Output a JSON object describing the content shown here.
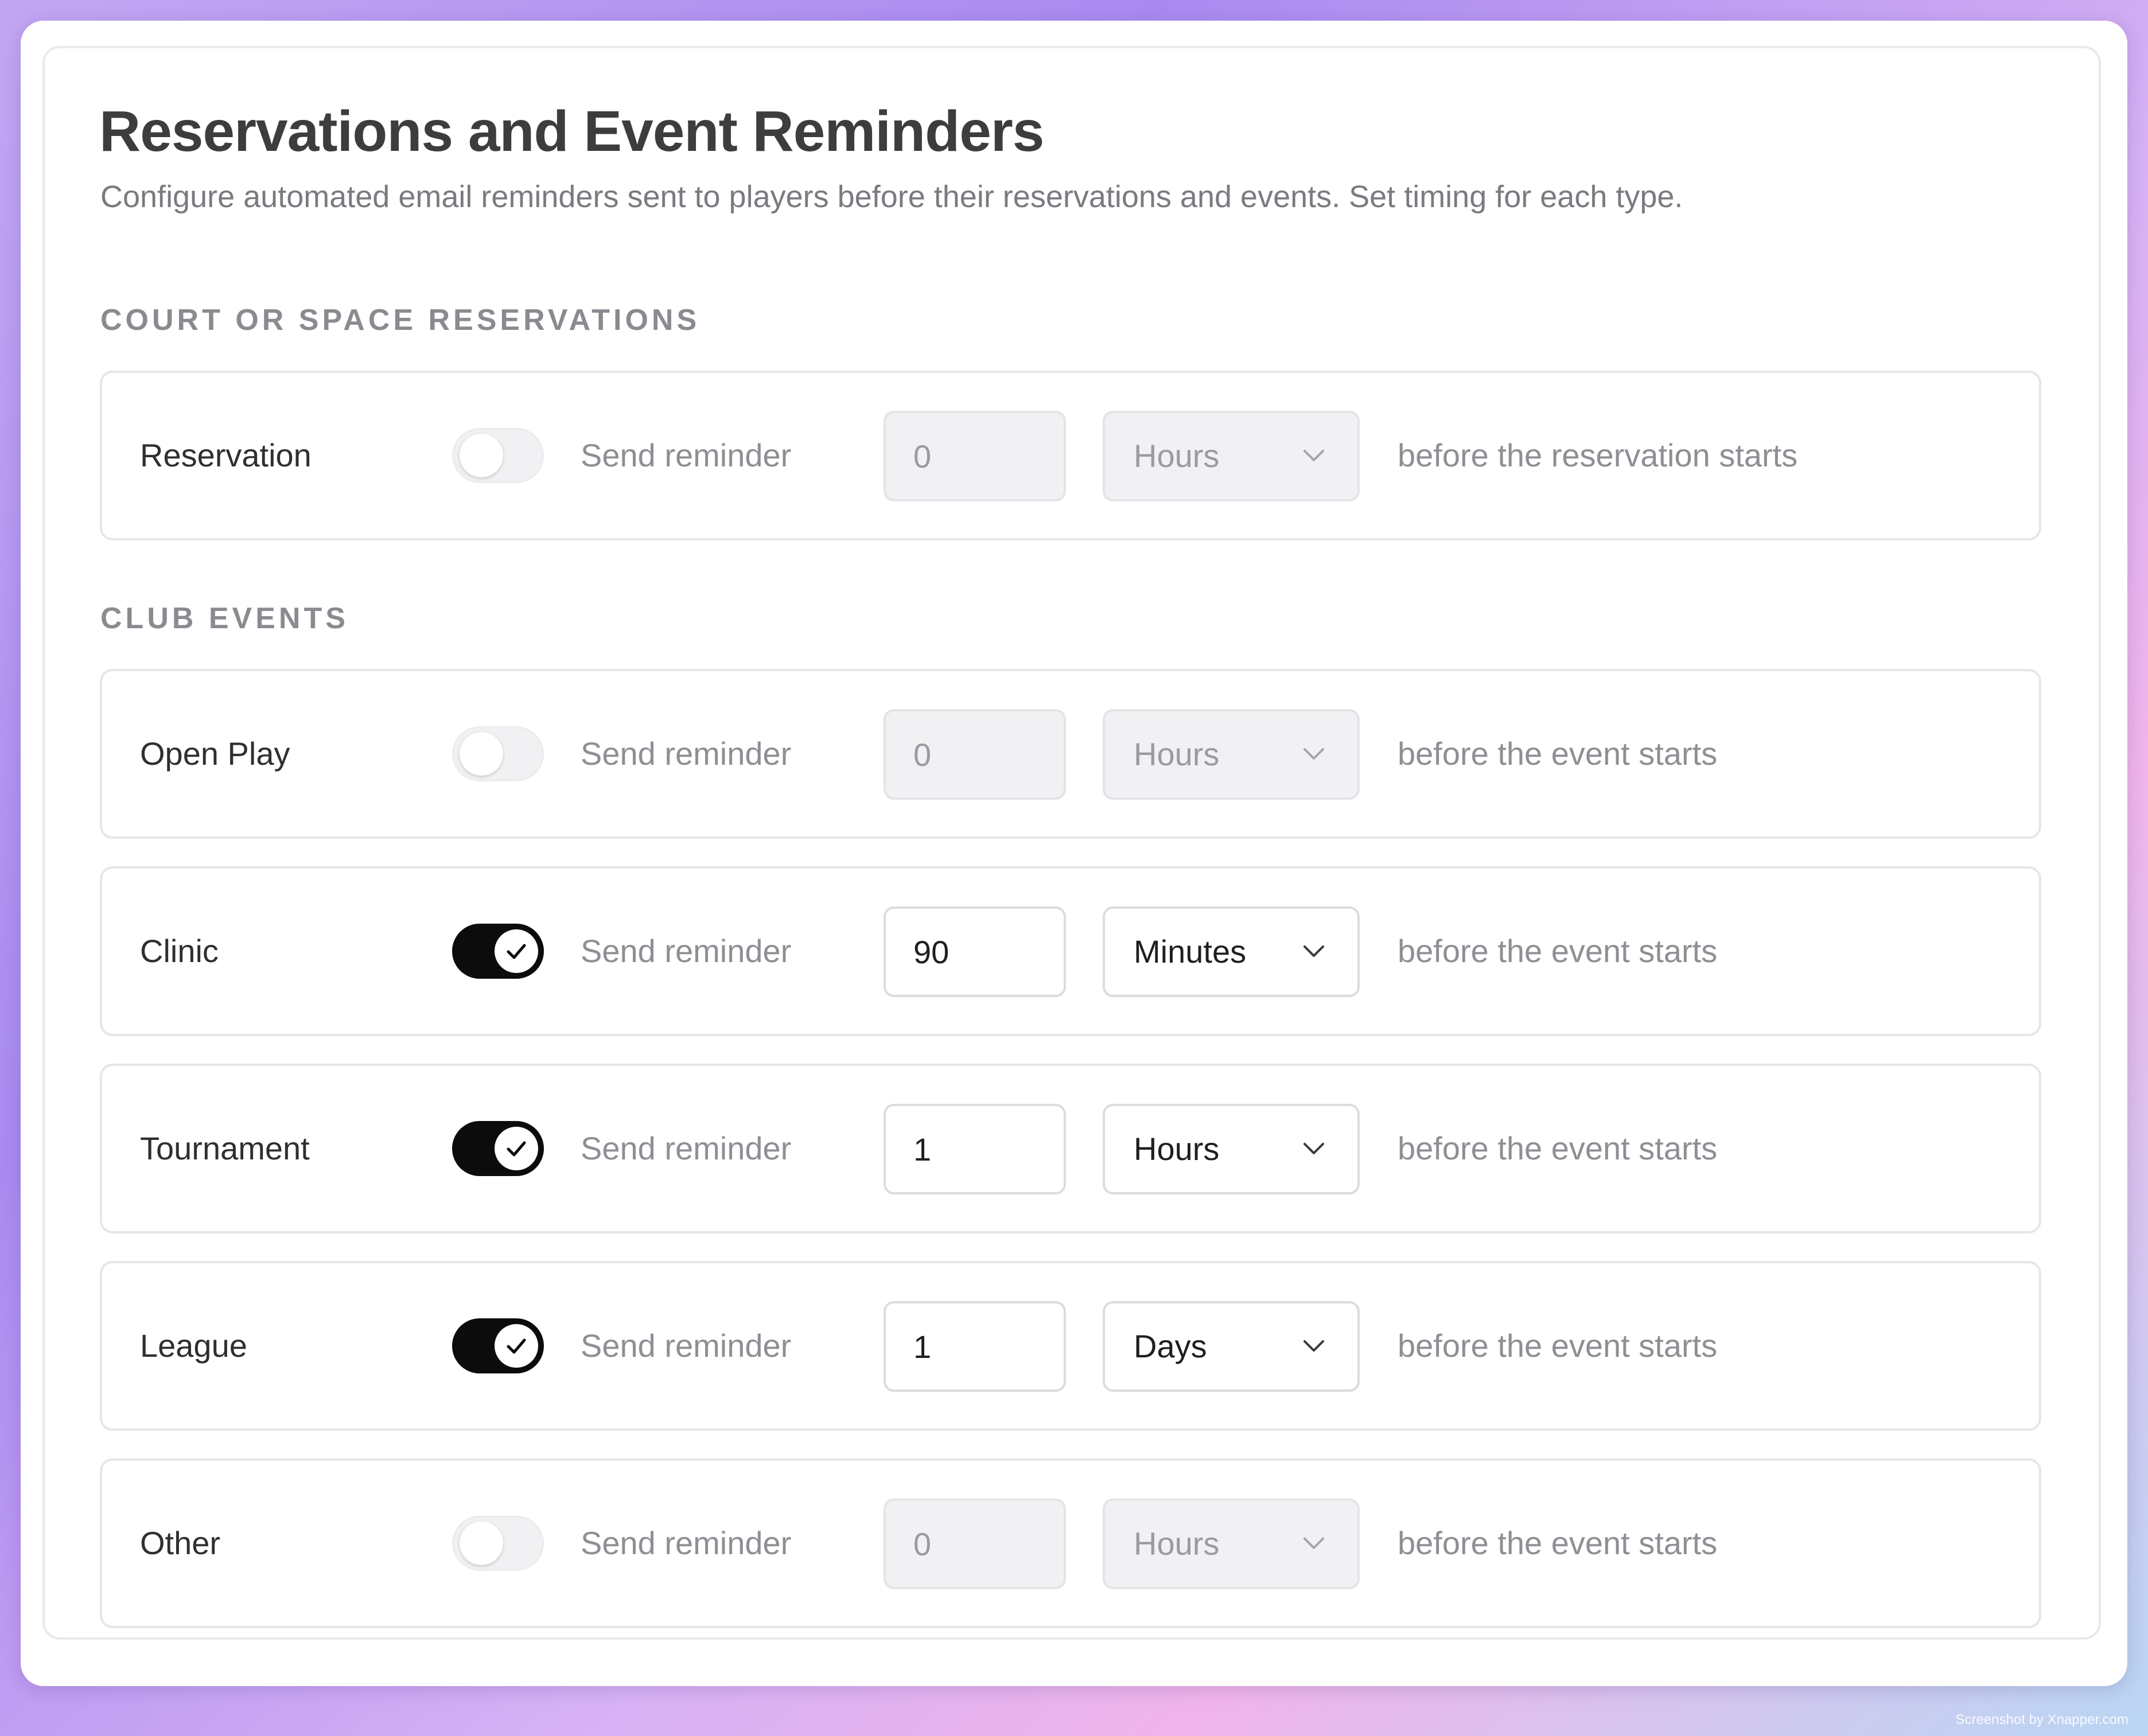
{
  "page": {
    "title": "Reservations and Event Reminders",
    "subtitle": "Configure automated email reminders sent to players before their reservations and events. Set timing for each type."
  },
  "sections": {
    "reservations_heading": "COURT OR SPACE RESERVATIONS",
    "events_heading": "CLUB EVENTS"
  },
  "rows": [
    {
      "label": "Reservation",
      "enabled": false,
      "send_label": "Send reminder",
      "amount": "0",
      "unit": "Hours",
      "suffix": "before the reservation starts"
    },
    {
      "label": "Open Play",
      "enabled": false,
      "send_label": "Send reminder",
      "amount": "0",
      "unit": "Hours",
      "suffix": "before the event starts"
    },
    {
      "label": "Clinic",
      "enabled": true,
      "send_label": "Send reminder",
      "amount": "90",
      "unit": "Minutes",
      "suffix": "before the event starts"
    },
    {
      "label": "Tournament",
      "enabled": true,
      "send_label": "Send reminder",
      "amount": "1",
      "unit": "Hours",
      "suffix": "before the event starts"
    },
    {
      "label": "League",
      "enabled": true,
      "send_label": "Send reminder",
      "amount": "1",
      "unit": "Days",
      "suffix": "before the event starts"
    },
    {
      "label": "Other",
      "enabled": false,
      "send_label": "Send reminder",
      "amount": "0",
      "unit": "Hours",
      "suffix": "before the event starts"
    }
  ],
  "icons": {
    "toggle_on": "check-icon",
    "select": "chevron-down-icon"
  },
  "colors": {
    "toggle_on": "#0c0c0d",
    "toggle_off": "#f1f1f3",
    "title": "#3d3d3f",
    "muted_text": "#8e8e94"
  },
  "watermark": "Screenshot by Xnapper.com"
}
